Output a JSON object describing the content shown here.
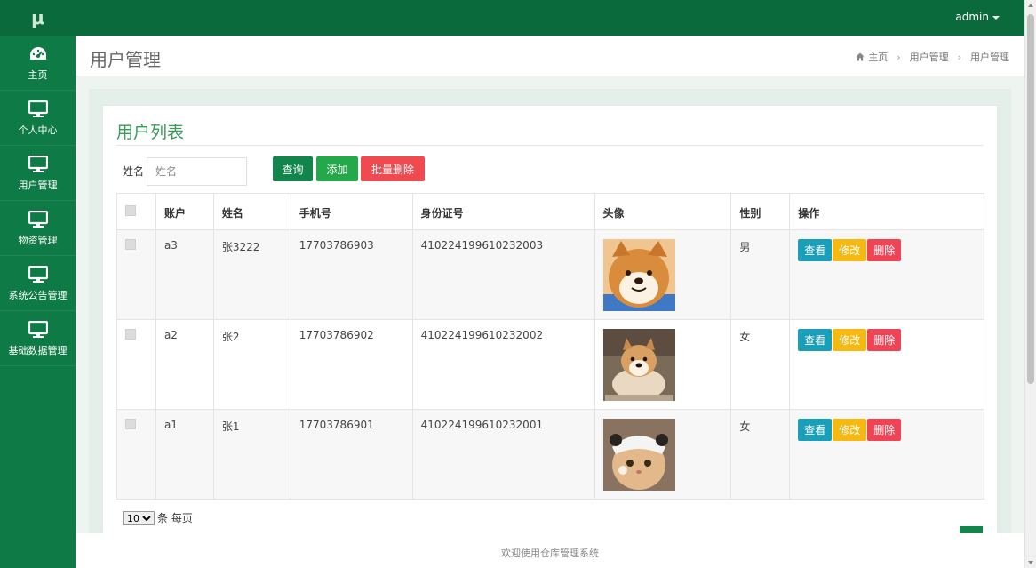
{
  "app": {
    "logo": "μ",
    "user": "admin"
  },
  "sidebar": {
    "items": [
      {
        "label": "主页",
        "icon": "dashboard-icon"
      },
      {
        "label": "个人中心",
        "icon": "monitor-icon"
      },
      {
        "label": "用户管理",
        "icon": "monitor-icon"
      },
      {
        "label": "物资管理",
        "icon": "monitor-icon"
      },
      {
        "label": "系统公告管理",
        "icon": "monitor-icon"
      },
      {
        "label": "基础数据管理",
        "icon": "monitor-icon"
      }
    ]
  },
  "header": {
    "title": "用户管理",
    "breadcrumb": [
      "主页",
      "用户管理",
      "用户管理"
    ]
  },
  "card": {
    "title": "用户列表",
    "search_label": "姓名",
    "search_placeholder": "姓名",
    "buttons": {
      "query": "查询",
      "add": "添加",
      "batch_delete": "批量删除"
    }
  },
  "table": {
    "columns": [
      "账户",
      "姓名",
      "手机号",
      "身份证号",
      "头像",
      "性别",
      "操作"
    ],
    "rows": [
      {
        "account": "a3",
        "name": "张3222",
        "phone": "17703786903",
        "id_number": "410224199610232003",
        "avatar": "shiba-dog-photo",
        "gender": "男"
      },
      {
        "account": "a2",
        "name": "张2",
        "phone": "17703786902",
        "id_number": "410224199610232002",
        "avatar": "shiba-puppy-photo",
        "gender": "女"
      },
      {
        "account": "a1",
        "name": "张1",
        "phone": "17703786901",
        "id_number": "410224199610232001",
        "avatar": "cat-with-hat-photo",
        "gender": "女"
      }
    ],
    "actions": {
      "view": "查看",
      "edit": "修改",
      "delete": "删除"
    }
  },
  "pager": {
    "page_size": "10",
    "suffix": "条 每页"
  },
  "footer": {
    "text": "欢迎使用仓库管理系统"
  },
  "colors": {
    "sidebar": "#0e7a46",
    "topbar": "#0b6a3c",
    "accent": "#3a9a5a",
    "view": "#1b9fb8",
    "edit": "#f6b911",
    "delete": "#ef4456"
  }
}
